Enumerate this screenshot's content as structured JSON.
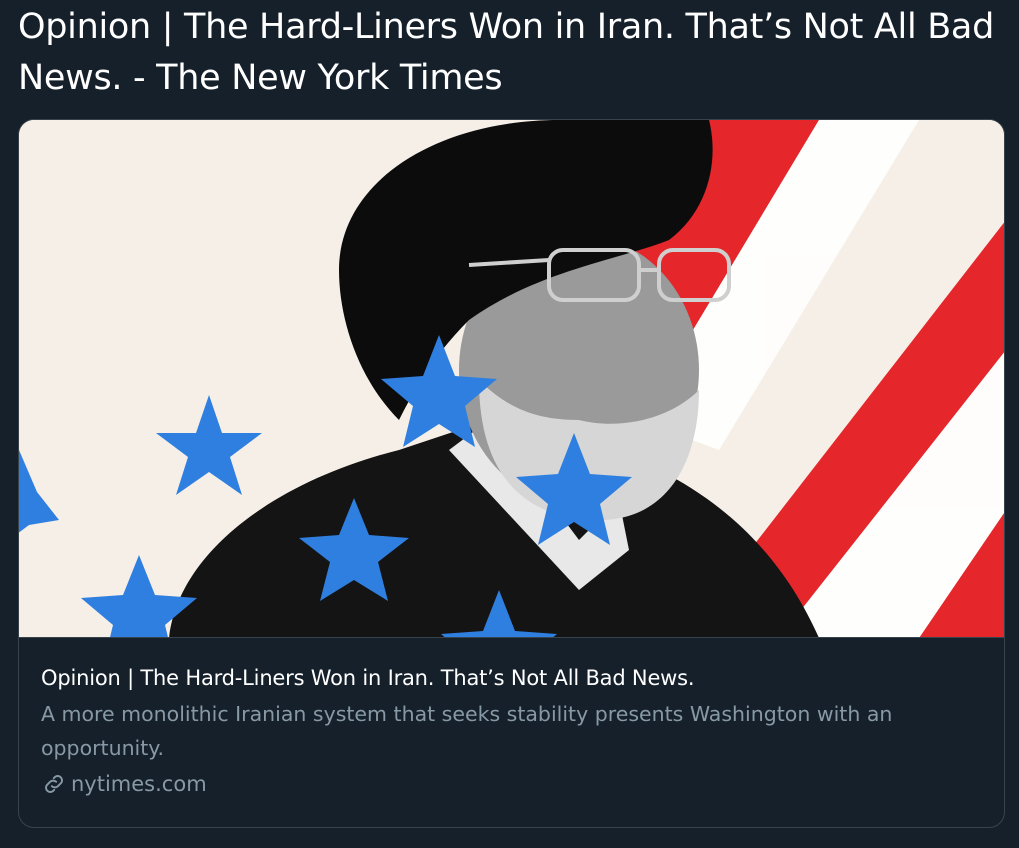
{
  "post": {
    "title": "Opinion | The Hard-Liners Won in Iran. That’s Not All Bad News. - The New York Times"
  },
  "card": {
    "image_alt": "Portrait with blue stars and red-white stripes",
    "title": "Opinion | The Hard-Liners Won in Iran. That’s Not All Bad News.",
    "description": "A more monolithic Iranian system that seeks stability presents Washington with an opportunity.",
    "domain": "nytimes.com",
    "domain_icon": "link-icon"
  },
  "colors": {
    "background": "#15202b",
    "border": "#38444d",
    "title_text": "#ffffff",
    "muted_text": "#8899a6",
    "star_blue": "#2f7fe0",
    "stripe_red": "#e5262b",
    "image_bg": "#f5efe8"
  }
}
